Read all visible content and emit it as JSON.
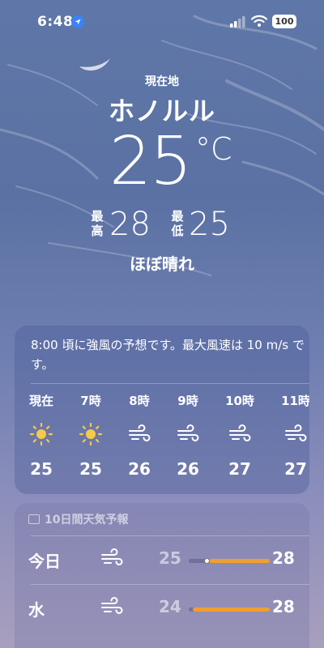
{
  "status": {
    "time": "6:48",
    "battery": "100",
    "location_icon": "location-arrow-icon",
    "signal_icon": "cellular-signal-icon",
    "wifi_icon": "wifi-icon"
  },
  "header": {
    "location_label": "現在地",
    "city": "ホノルル",
    "temperature": "25",
    "unit": "°C",
    "high_label": "最高",
    "high": "28",
    "low_label": "最低",
    "low": "25",
    "condition": "ほぼ晴れ"
  },
  "hourly": {
    "alert_text": "8:00 頃に強風の予想です。最大風速は 10 m/s です。",
    "items": [
      {
        "time": "現在",
        "icon": "sun-icon",
        "temp": "25"
      },
      {
        "time": "7時",
        "icon": "sun-icon",
        "temp": "25"
      },
      {
        "time": "8時",
        "icon": "wind-icon",
        "temp": "26"
      },
      {
        "time": "9時",
        "icon": "wind-icon",
        "temp": "26"
      },
      {
        "time": "10時",
        "icon": "wind-icon",
        "temp": "27"
      },
      {
        "time": "11時",
        "icon": "wind-icon",
        "temp": "27"
      }
    ]
  },
  "ten_day": {
    "title": "10日間天気予報",
    "title_icon": "calendar-icon",
    "days": [
      {
        "name": "今日",
        "icon": "wind-icon",
        "low": "25",
        "high": "28",
        "range_start": 0.25,
        "range_end": 1.0,
        "current": 0.22
      },
      {
        "name": "水",
        "icon": "wind-icon",
        "low": "24",
        "high": "28",
        "range_start": 0.05,
        "range_end": 1.0
      }
    ]
  },
  "colors": {
    "accent_bar": "#f0a030",
    "sun": "#f7c948",
    "location_blue": "#3b82f6"
  }
}
